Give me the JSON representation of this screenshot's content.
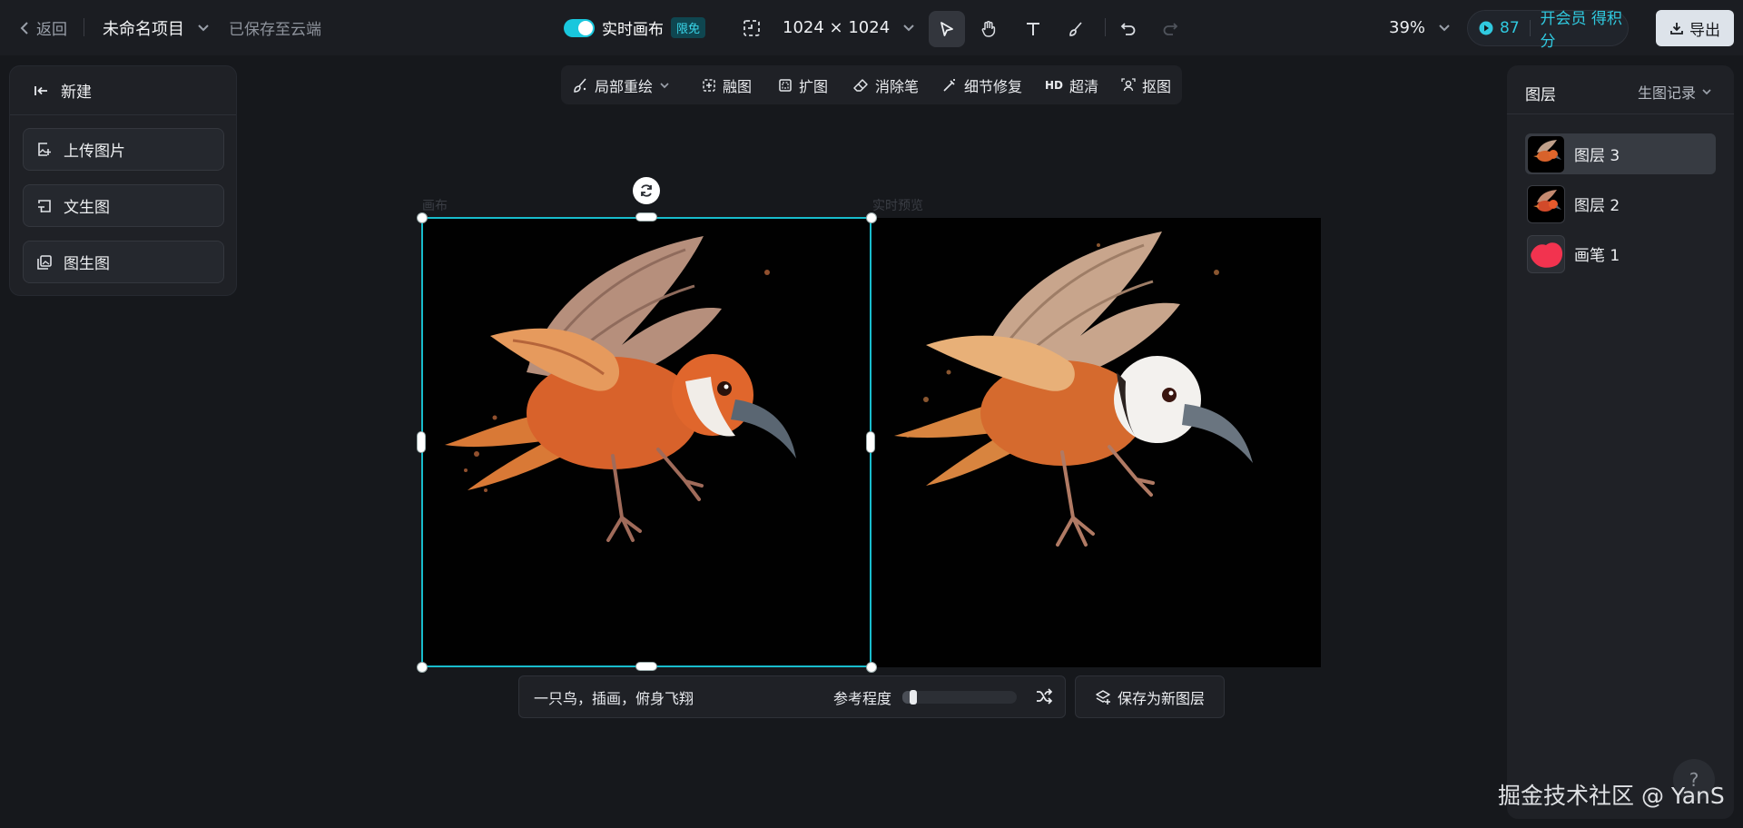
{
  "header": {
    "back_label": "返回",
    "project_name": "未命名项目",
    "save_status": "已保存至云端",
    "live_canvas_label": "实时画布",
    "free_badge": "限免",
    "canvas_size": "1024 × 1024",
    "zoom": "39%",
    "credits": "87",
    "membership_link": "开会员 得积分",
    "export_label": "导出",
    "accent_color": "#19c7dd"
  },
  "tools": [
    "select-icon",
    "hand-icon",
    "text-icon",
    "brush-icon",
    "undo-icon",
    "redo-icon"
  ],
  "left_panel": {
    "new_label": "新建",
    "buttons": [
      "上传图片",
      "文生图",
      "图生图"
    ]
  },
  "canvas_toolbar": {
    "items": [
      "局部重绘",
      "融图",
      "扩图",
      "消除笔",
      "细节修复",
      "超清",
      "抠图"
    ],
    "hd_tag": "HD"
  },
  "canvas": {
    "label_left": "画布",
    "label_right": "实时预览"
  },
  "prompt_bar": {
    "prompt_text": "一只鸟，插画，俯身飞翔",
    "reference_label": "参考程度",
    "reference_level": 0.06,
    "save_as_layer": "保存为新图层"
  },
  "right_panel": {
    "title": "图层",
    "history_label": "生图记录",
    "layers": [
      "图层 3",
      "图层 2",
      "画笔 1"
    ],
    "selected_layer": "图层 3"
  },
  "watermark": "掘金技术社区 @ YanS",
  "help_label": "?"
}
